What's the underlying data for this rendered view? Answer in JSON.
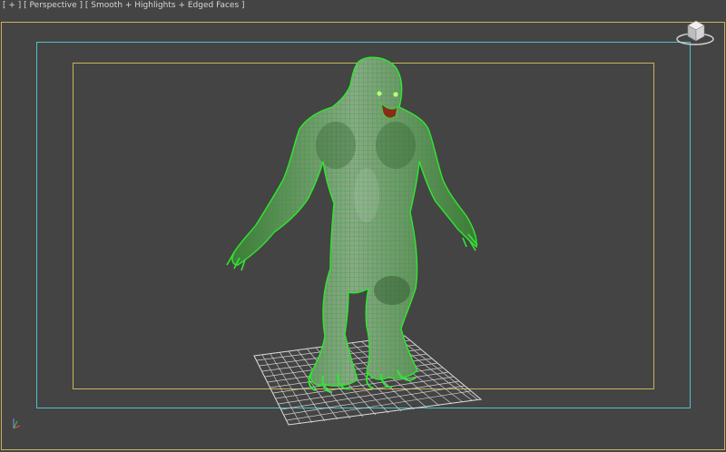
{
  "viewport": {
    "menu_plus": "[ + ]",
    "menu_view": "[ Perspective ]",
    "menu_shading": "[ Smooth + Highlights + Edged Faces ]"
  },
  "colors": {
    "background": "#444444",
    "safe_frame_outer": "#c9b25a",
    "safe_frame_render": "#4fc1c9",
    "wireframe_green": "#2ee82e",
    "grid": "#e0e0e0"
  },
  "icons": {
    "viewcube": "viewcube-icon",
    "axis": "axis-tripod-icon"
  }
}
